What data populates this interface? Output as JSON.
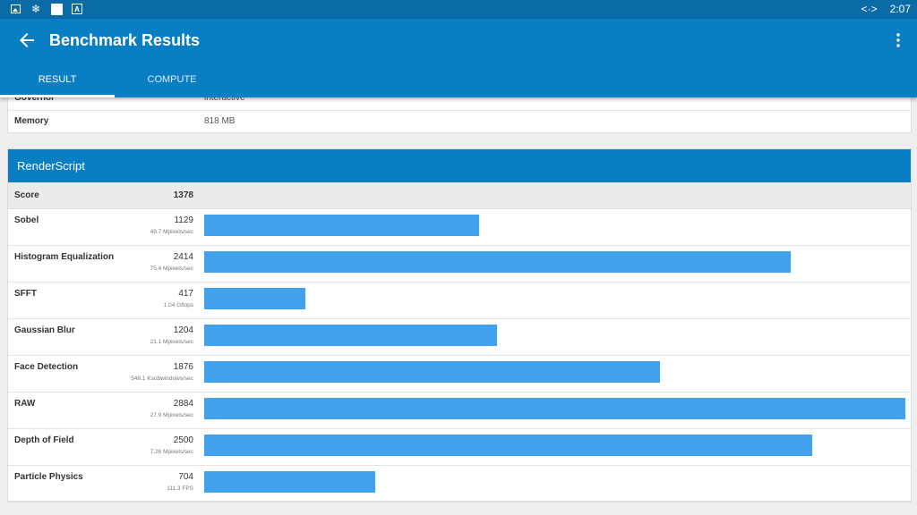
{
  "status_bar": {
    "icons": [
      "image-icon",
      "snowflake-icon",
      "white-square-icon",
      "a-box-icon"
    ],
    "code_icon": "<·>",
    "time": "2:07"
  },
  "app_bar": {
    "title": "Benchmark Results",
    "tabs": [
      {
        "label": "RESULT",
        "selected": true
      },
      {
        "label": "COMPUTE",
        "selected": false
      }
    ]
  },
  "system_info": {
    "rows": [
      {
        "key": "Governor",
        "value": "interactive"
      },
      {
        "key": "Memory",
        "value": "818 MB"
      }
    ]
  },
  "renderscript": {
    "header": "RenderScript",
    "score_label": "Score",
    "score_value": "1378",
    "max_score": 2884,
    "bar_color": "#42a1ec",
    "benchmarks": [
      {
        "name": "Sobel",
        "score": "1129",
        "unit": "49.7 Mpixels/sec",
        "value": 1129
      },
      {
        "name": "Histogram Equalization",
        "score": "2414",
        "unit": "75.4 Mpixels/sec",
        "value": 2414
      },
      {
        "name": "SFFT",
        "score": "417",
        "unit": "1.04 Gflops",
        "value": 417
      },
      {
        "name": "Gaussian Blur",
        "score": "1204",
        "unit": "21.1 Mpixels/sec",
        "value": 1204
      },
      {
        "name": "Face Detection",
        "score": "1876",
        "unit": "548.1 Ksubwindows/sec",
        "value": 1876
      },
      {
        "name": "RAW",
        "score": "2884",
        "unit": "27.9 Mpixels/sec",
        "value": 2884
      },
      {
        "name": "Depth of Field",
        "score": "2500",
        "unit": "7.26 Mpixels/sec",
        "value": 2500
      },
      {
        "name": "Particle Physics",
        "score": "704",
        "unit": "111.3 FPS",
        "value": 704
      }
    ]
  },
  "colors": {
    "status_bar": "#0a6ba6",
    "app_bar": "#0a7ec2",
    "background": "#eeeeee"
  }
}
